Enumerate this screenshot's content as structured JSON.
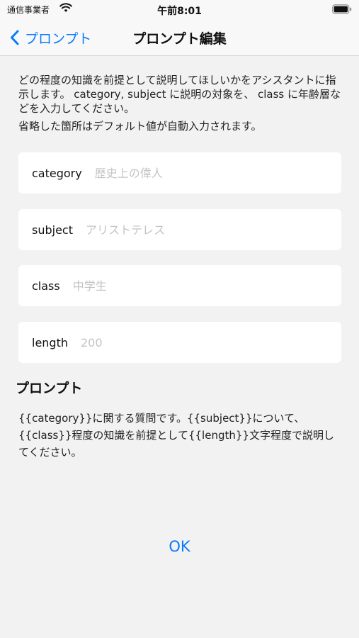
{
  "status_bar": {
    "carrier": "通信事業者",
    "time": "午前8:01",
    "wifi_icon": "wifi-icon",
    "battery_icon": "battery-icon"
  },
  "nav": {
    "back_label": "プロンプト",
    "back_icon": "chevron-left-icon",
    "title": "プロンプト編集"
  },
  "description": {
    "text": "どの程度の知識を前提として説明してほしいかをアシスタントに指示します。 category, subject に説明の対象を、 class に年齢層などを入力してください。",
    "note": "省略した箇所はデフォルト値が自動入力されます。"
  },
  "fields": [
    {
      "label": "category",
      "value": "",
      "placeholder": "歴史上の偉人"
    },
    {
      "label": "subject",
      "value": "",
      "placeholder": "アリストテレス"
    },
    {
      "label": "class",
      "value": "",
      "placeholder": "中学生"
    },
    {
      "label": "length",
      "value": "",
      "placeholder": "200"
    }
  ],
  "prompt_section": {
    "heading": "プロンプト",
    "template": "{{category}}に関する質問です。{{subject}}について、{{class}}程度の知識を前提として{{length}}文字程度で説明してください。"
  },
  "ok_label": "OK",
  "colors": {
    "accent": "#0a7aff",
    "background": "#f2f2f2",
    "card": "#ffffff"
  }
}
